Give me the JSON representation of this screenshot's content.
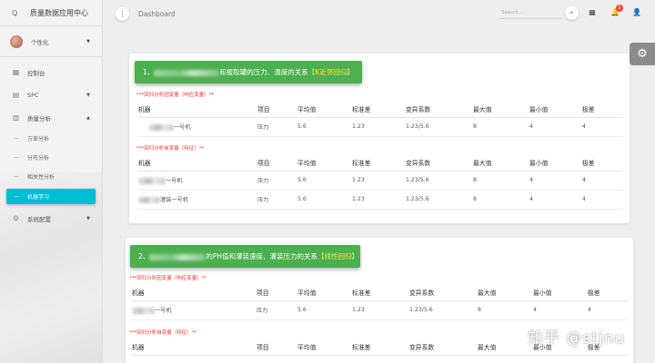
{
  "sidebar": {
    "logo": "Q",
    "brand": "质量数据应用中心",
    "user": "个性化",
    "items": [
      {
        "label": "控制台",
        "icon": "dashboard-icon"
      },
      {
        "label": "SPC",
        "icon": "chart-icon"
      },
      {
        "label": "质量分析",
        "icon": "analysis-icon"
      },
      {
        "label": "系统配置",
        "icon": "gear-icon"
      }
    ],
    "subitems": [
      {
        "label": "方差分析",
        "dash": "—"
      },
      {
        "label": "分布分析",
        "dash": "—"
      },
      {
        "label": "相关性分析",
        "dash": "—"
      },
      {
        "label": "机器学习",
        "dash": "—"
      }
    ]
  },
  "topbar": {
    "breadcrumb": "Dashboard",
    "search_placeholder": "Search...",
    "notification_count": "5"
  },
  "card1": {
    "heading_prefix": "1、",
    "heading_suffix": "和报取罐的压力、温度的关系",
    "heading_method": "【K近邻回归】",
    "response_title": "***回归分析因变量（响应变量）**",
    "feature_title": "***回归分析自变量（特征）**",
    "columns": [
      "机器",
      "项目",
      "平均值",
      "标准差",
      "变异系数",
      "最大值",
      "最小值",
      "极差"
    ],
    "response_rows": [
      [
        "一号机",
        "压力",
        "5.6",
        "1.23",
        "1.23/5.6",
        "8",
        "4",
        "4"
      ]
    ],
    "feature_rows": [
      [
        "一号机",
        "压力",
        "5.6",
        "1.23",
        "1.23/5.6",
        "8",
        "4",
        "4"
      ],
      [
        "灌装一号机",
        "压力",
        "5.6",
        "1.23",
        "1.23/5.6",
        "8",
        "4",
        "4"
      ]
    ]
  },
  "card2": {
    "heading_prefix": "2、",
    "heading_suffix": "的PH值和灌装速度、灌装压力的关系",
    "heading_method": "【线性回归】",
    "response_title": "***回归分析因变量（响应变量）**",
    "feature_title": "***回归分析自变量（特征）**",
    "columns": [
      "机器",
      "项目",
      "平均值",
      "标准差",
      "变异系数",
      "最大值",
      "最小值",
      "极差"
    ],
    "response_rows": [
      [
        "一号机",
        "压力",
        "5.6",
        "1.23",
        "1.23/5.6",
        "8",
        "4",
        "4"
      ]
    ]
  },
  "watermark": "知乎 @stjnu"
}
